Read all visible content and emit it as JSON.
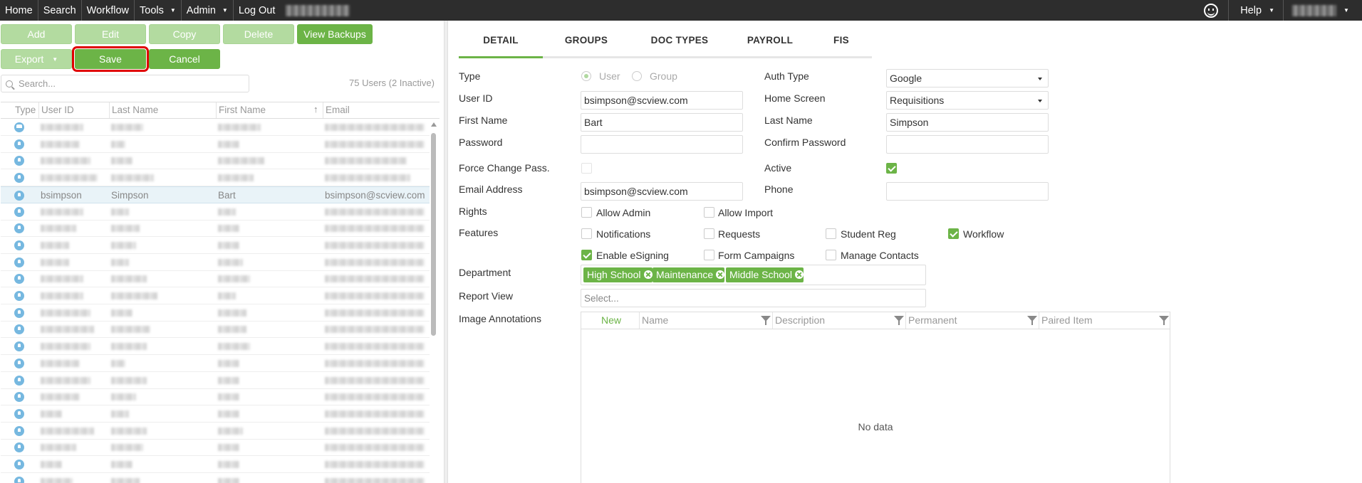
{
  "nav": {
    "home": "Home",
    "search": "Search",
    "workflow": "Workflow",
    "tools": "Tools",
    "admin": "Admin",
    "logout": "Log Out",
    "help": "Help"
  },
  "toolbar": {
    "add": "Add",
    "edit": "Edit",
    "copy": "Copy",
    "delete": "Delete",
    "view_backups": "View Backups",
    "export": "Export",
    "save": "Save",
    "cancel": "Cancel"
  },
  "left": {
    "search_placeholder": "Search...",
    "user_count": "75 Users (2 Inactive)",
    "columns": [
      "Type",
      "User ID",
      "Last Name",
      "First Name",
      "Email"
    ],
    "selected_row": {
      "user_id": "bsimpson",
      "last_name": "Simpson",
      "first_name": "Bart",
      "email": "bsimpson@scview.com"
    }
  },
  "tabs": [
    "DETAIL",
    "GROUPS",
    "DOC TYPES",
    "PAYROLL",
    "FIS"
  ],
  "detail": {
    "type_label": "Type",
    "type_user": "User",
    "type_group": "Group",
    "auth_type_label": "Auth Type",
    "auth_type_value": "Google",
    "user_id_label": "User ID",
    "user_id_value": "bsimpson@scview.com",
    "home_screen_label": "Home Screen",
    "home_screen_value": "Requisitions",
    "first_name_label": "First Name",
    "first_name_value": "Bart",
    "last_name_label": "Last Name",
    "last_name_value": "Simpson",
    "password_label": "Password",
    "confirm_password_label": "Confirm Password",
    "force_change_label": "Force Change Pass.",
    "active_label": "Active",
    "email_label": "Email Address",
    "email_value": "bsimpson@scview.com",
    "phone_label": "Phone",
    "rights_label": "Rights",
    "allow_admin": "Allow Admin",
    "allow_import": "Allow Import",
    "features_label": "Features",
    "notifications": "Notifications",
    "requests": "Requests",
    "student_reg": "Student Reg",
    "workflow": "Workflow",
    "enable_esigning": "Enable eSigning",
    "form_campaigns": "Form Campaigns",
    "manage_contacts": "Manage Contacts",
    "department_label": "Department",
    "departments": [
      "High School",
      "Maintenance",
      "Middle School"
    ],
    "report_view_label": "Report View",
    "report_view_placeholder": "Select...",
    "image_annotations_label": "Image Annotations",
    "ann_columns": [
      "New",
      "Name",
      "Description",
      "Permanent",
      "Paired Item"
    ],
    "no_data": "No data"
  },
  "colors": {
    "accent": "#6cb447",
    "nav_bg": "#2d2d2d",
    "highlight": "#e00000"
  }
}
